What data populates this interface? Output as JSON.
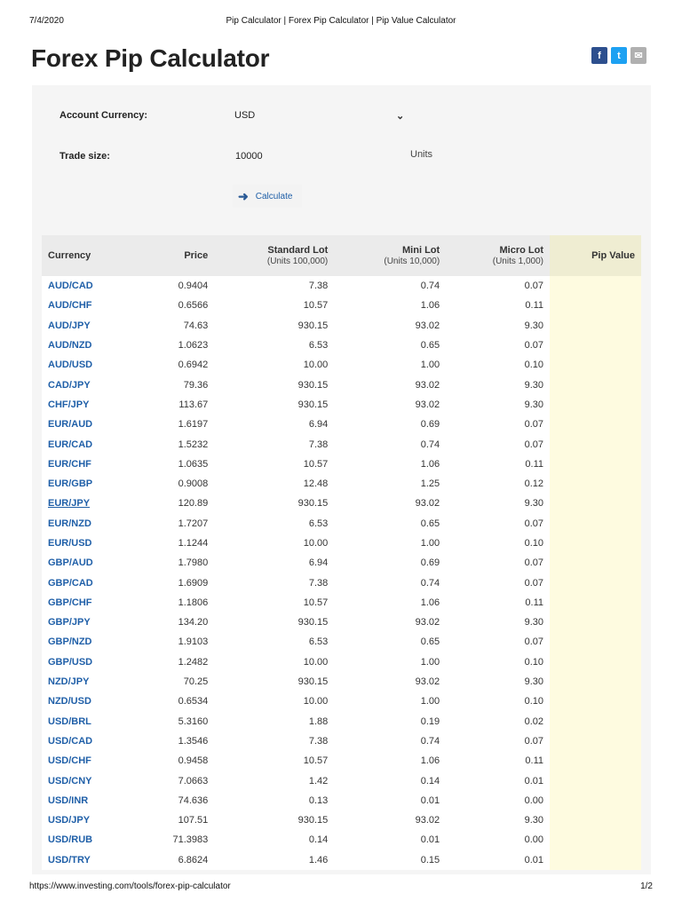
{
  "print_header": {
    "date": "7/4/2020",
    "title": "Pip Calculator | Forex Pip Calculator | Pip Value Calculator"
  },
  "page_title": "Forex Pip Calculator",
  "social": {
    "facebook": "f",
    "twitter": "t",
    "email": "✉"
  },
  "form": {
    "account_currency_label": "Account Currency:",
    "account_currency_value": "USD",
    "trade_size_label": "Trade size:",
    "trade_size_value": "10000",
    "units_label": "Units",
    "calculate_label": "Calculate"
  },
  "table": {
    "headers": {
      "currency": "Currency",
      "price": "Price",
      "standard": "Standard Lot",
      "standard_sub": "(Units 100,000)",
      "mini": "Mini Lot",
      "mini_sub": "(Units 10,000)",
      "micro": "Micro Lot",
      "micro_sub": "(Units 1,000)",
      "pip": "Pip Value"
    },
    "rows": [
      [
        "AUD/CAD",
        "0.9404",
        "7.38",
        "0.74",
        "0.07"
      ],
      [
        "AUD/CHF",
        "0.6566",
        "10.57",
        "1.06",
        "0.11"
      ],
      [
        "AUD/JPY",
        "74.63",
        "930.15",
        "93.02",
        "9.30"
      ],
      [
        "AUD/NZD",
        "1.0623",
        "6.53",
        "0.65",
        "0.07"
      ],
      [
        "AUD/USD",
        "0.6942",
        "10.00",
        "1.00",
        "0.10"
      ],
      [
        "CAD/JPY",
        "79.36",
        "930.15",
        "93.02",
        "9.30"
      ],
      [
        "CHF/JPY",
        "113.67",
        "930.15",
        "93.02",
        "9.30"
      ],
      [
        "EUR/AUD",
        "1.6197",
        "6.94",
        "0.69",
        "0.07"
      ],
      [
        "EUR/CAD",
        "1.5232",
        "7.38",
        "0.74",
        "0.07"
      ],
      [
        "EUR/CHF",
        "1.0635",
        "10.57",
        "1.06",
        "0.11"
      ],
      [
        "EUR/GBP",
        "0.9008",
        "12.48",
        "1.25",
        "0.12"
      ],
      [
        "EUR/JPY",
        "120.89",
        "930.15",
        "93.02",
        "9.30"
      ],
      [
        "EUR/NZD",
        "1.7207",
        "6.53",
        "0.65",
        "0.07"
      ],
      [
        "EUR/USD",
        "1.1244",
        "10.00",
        "1.00",
        "0.10"
      ],
      [
        "GBP/AUD",
        "1.7980",
        "6.94",
        "0.69",
        "0.07"
      ],
      [
        "GBP/CAD",
        "1.6909",
        "7.38",
        "0.74",
        "0.07"
      ],
      [
        "GBP/CHF",
        "1.1806",
        "10.57",
        "1.06",
        "0.11"
      ],
      [
        "GBP/JPY",
        "134.20",
        "930.15",
        "93.02",
        "9.30"
      ],
      [
        "GBP/NZD",
        "1.9103",
        "6.53",
        "0.65",
        "0.07"
      ],
      [
        "GBP/USD",
        "1.2482",
        "10.00",
        "1.00",
        "0.10"
      ],
      [
        "NZD/JPY",
        "70.25",
        "930.15",
        "93.02",
        "9.30"
      ],
      [
        "NZD/USD",
        "0.6534",
        "10.00",
        "1.00",
        "0.10"
      ],
      [
        "USD/BRL",
        "5.3160",
        "1.88",
        "0.19",
        "0.02"
      ],
      [
        "USD/CAD",
        "1.3546",
        "7.38",
        "0.74",
        "0.07"
      ],
      [
        "USD/CHF",
        "0.9458",
        "10.57",
        "1.06",
        "0.11"
      ],
      [
        "USD/CNY",
        "7.0663",
        "1.42",
        "0.14",
        "0.01"
      ],
      [
        "USD/INR",
        "74.636",
        "0.13",
        "0.01",
        "0.00"
      ],
      [
        "USD/JPY",
        "107.51",
        "930.15",
        "93.02",
        "9.30"
      ],
      [
        "USD/RUB",
        "71.3983",
        "0.14",
        "0.01",
        "0.00"
      ],
      [
        "USD/TRY",
        "6.8624",
        "1.46",
        "0.15",
        "0.01"
      ]
    ],
    "hovered_row": "EUR/JPY"
  },
  "print_footer": {
    "url": "https://www.investing.com/tools/forex-pip-calculator",
    "page": "1/2"
  },
  "colors": {
    "link": "#1f5fa8",
    "pip_column": "#fefbe0",
    "panel": "#f5f5f5"
  }
}
